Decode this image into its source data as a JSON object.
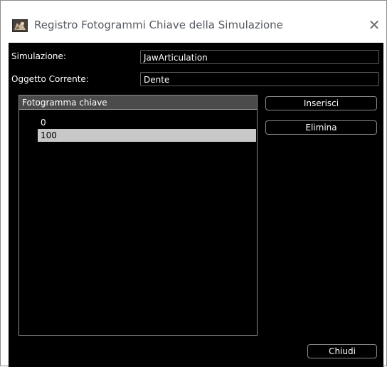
{
  "window": {
    "title": "Registro Fotogrammi Chiave della Simulazione",
    "close_glyph": "✕",
    "icon": "app-icon"
  },
  "form": {
    "simulation_label": "Simulazione:",
    "simulation_value": "JawArticulation",
    "object_label": "Oggetto Corrente:",
    "object_value": "Dente"
  },
  "keyframes": {
    "column_header": "Fotogramma chiave",
    "items": [
      {
        "label": "0",
        "selected": false
      },
      {
        "label": "100",
        "selected": true
      }
    ]
  },
  "buttons": {
    "insert_label": "Inserisci",
    "delete_label": "Elimina",
    "close_label": "Chiudi"
  },
  "colors": {
    "client_background": "#000000",
    "selection_background": "#c8c8c8",
    "header_background": "#4b4b4b"
  }
}
